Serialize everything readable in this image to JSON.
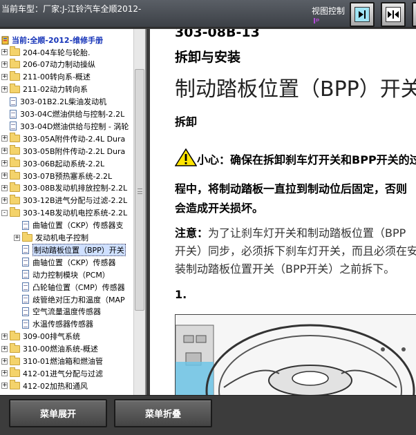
{
  "titlebar": {
    "car_model": "当前车型：厂家:J-江铃汽车全顺2012-",
    "view_control_label": "视图控制",
    "view_mark": "Iᵖ"
  },
  "view_buttons": [
    {
      "name": "view-right-button",
      "glyph": "▸|"
    },
    {
      "name": "view-split-button",
      "glyph": "◂▸"
    },
    {
      "name": "view-left-button",
      "glyph": "|◂"
    }
  ],
  "tree": {
    "root_label": "当前:全顺-2012-维修手册",
    "items": [
      {
        "type": "folder",
        "expander": "+",
        "indent": 0,
        "label": "204-04车轮与轮胎."
      },
      {
        "type": "folder",
        "expander": "+",
        "indent": 0,
        "label": "206-07动力制动操纵"
      },
      {
        "type": "folder",
        "expander": "+",
        "indent": 0,
        "label": "211-00转向系-概述"
      },
      {
        "type": "folder",
        "expander": "+",
        "indent": 0,
        "label": "211-02动力转向系"
      },
      {
        "type": "doc",
        "expander": "",
        "indent": 0,
        "label": "303-01B2.2L柴油发动机"
      },
      {
        "type": "doc",
        "expander": "",
        "indent": 0,
        "label": "303-04C燃油供给与控制-2.2L"
      },
      {
        "type": "doc",
        "expander": "",
        "indent": 0,
        "label": "303-04D燃油供给与控制 - 涡轮"
      },
      {
        "type": "folder",
        "expander": "+",
        "indent": 0,
        "label": "303-05A附件传动-2.4L Dura"
      },
      {
        "type": "folder",
        "expander": "+",
        "indent": 0,
        "label": "303-05B附件传动-2.2L Dura"
      },
      {
        "type": "folder",
        "expander": "+",
        "indent": 0,
        "label": "303-06B起动系统-2.2L"
      },
      {
        "type": "folder",
        "expander": "+",
        "indent": 0,
        "label": "303-07B预热塞系统-2.2L"
      },
      {
        "type": "folder",
        "expander": "+",
        "indent": 0,
        "label": "303-08B发动机排放控制-2.2L"
      },
      {
        "type": "folder",
        "expander": "+",
        "indent": 0,
        "label": "303-12B进气分配与过滤-2.2L"
      },
      {
        "type": "folder",
        "expander": "-",
        "indent": 0,
        "label": "303-14B发动机电控系统-2.2L"
      },
      {
        "type": "doc",
        "expander": "",
        "indent": 1,
        "label": "曲轴位置（CKP）传感器支"
      },
      {
        "type": "folder",
        "expander": "+",
        "indent": 1,
        "label": "发动机电子控制"
      },
      {
        "type": "doc",
        "expander": "",
        "indent": 1,
        "label": "制动踏板位置（BPP）开关",
        "selected": true
      },
      {
        "type": "doc",
        "expander": "",
        "indent": 1,
        "label": "曲轴位置（CKP）传感器"
      },
      {
        "type": "doc",
        "expander": "",
        "indent": 1,
        "label": "动力控制模块（PCM）"
      },
      {
        "type": "doc",
        "expander": "",
        "indent": 1,
        "label": "凸轮轴位置（CMP）传感器"
      },
      {
        "type": "doc",
        "expander": "",
        "indent": 1,
        "label": "歧管绝对压力和温度（MAP"
      },
      {
        "type": "doc",
        "expander": "",
        "indent": 1,
        "label": "空气流量温度传感器"
      },
      {
        "type": "doc",
        "expander": "",
        "indent": 1,
        "label": "水温传感器传感器"
      },
      {
        "type": "folder",
        "expander": "+",
        "indent": 0,
        "label": "309-00排气系统"
      },
      {
        "type": "folder",
        "expander": "+",
        "indent": 0,
        "label": "310-00燃油系统-概述"
      },
      {
        "type": "folder",
        "expander": "+",
        "indent": 0,
        "label": "310-01燃油箱和燃油管"
      },
      {
        "type": "folder",
        "expander": "+",
        "indent": 0,
        "label": "412-01进气分配与过滤"
      },
      {
        "type": "folder",
        "expander": "+",
        "indent": 0,
        "label": "412-02加热和通风"
      }
    ]
  },
  "document": {
    "section_number": "303-08B-13",
    "section_title": "拆卸与安装",
    "main_heading": "制动踏板位置（BPP）开关",
    "sub_heading": "拆卸",
    "caution_label": "小心：",
    "caution_line1": "确保在拆卸刹车灯开关和BPP开关的过",
    "caution_line2": "程中，将制动踏板一直拉到制动位后固定，否则",
    "caution_line3": "会造成开关损坏。",
    "note_label": "注意：",
    "note_line1": "为了让刹车灯开关和制动踏板位置（BPP",
    "note_line2": "开关）同步，必须拆下刹车灯开关，而且必须在安",
    "note_line3": "装制动踏板位置开关（BPP开关）之前拆下。",
    "step_number": "1."
  },
  "bottom": {
    "expand_label": "菜单展开",
    "collapse_label": "菜单折叠"
  }
}
